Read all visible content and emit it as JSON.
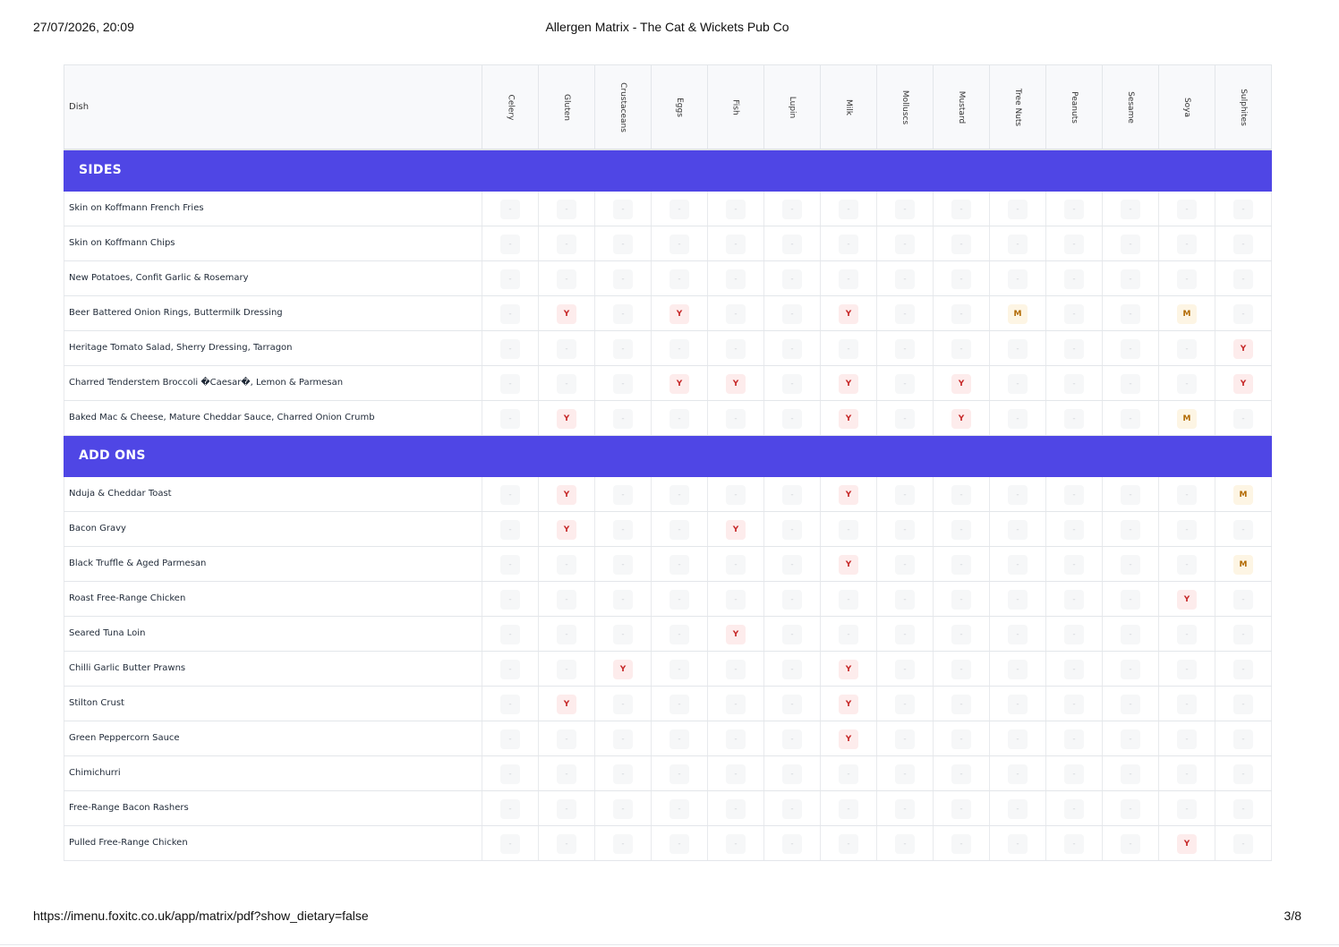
{
  "print_header": {
    "date": "27/07/2026, 20:09",
    "title": "Allergen Matrix - The Cat & Wickets Pub Co"
  },
  "print_footer": {
    "url": "https://imenu.foxitc.co.uk/app/matrix/pdf?show_dietary=false",
    "page": "3/8"
  },
  "colors": {
    "section_bg": "#4f46e5",
    "yes_bg": "#fdecec",
    "yes_text": "#c62828",
    "may_bg": "#fdf5e4",
    "may_text": "#b26a00"
  },
  "table": {
    "dish_header": "Dish",
    "allergens": [
      "Celery",
      "Gluten",
      "Crustaceans",
      "Eggs",
      "Fish",
      "Lupin",
      "Milk",
      "Molluscs",
      "Mustard",
      "Tree Nuts",
      "Peanuts",
      "Sesame",
      "Soya",
      "Sulphites"
    ],
    "sections": [
      {
        "title": "SIDES",
        "rows": [
          {
            "dish": "Skin on Koffmann French Fries",
            "values": [
              "-",
              "-",
              "-",
              "-",
              "-",
              "-",
              "-",
              "-",
              "-",
              "-",
              "-",
              "-",
              "-",
              "-"
            ]
          },
          {
            "dish": "Skin on Koffmann Chips",
            "values": [
              "-",
              "-",
              "-",
              "-",
              "-",
              "-",
              "-",
              "-",
              "-",
              "-",
              "-",
              "-",
              "-",
              "-"
            ]
          },
          {
            "dish": "New Potatoes, Confit Garlic & Rosemary",
            "values": [
              "-",
              "-",
              "-",
              "-",
              "-",
              "-",
              "-",
              "-",
              "-",
              "-",
              "-",
              "-",
              "-",
              "-"
            ]
          },
          {
            "dish": "Beer Battered Onion Rings, Buttermilk Dressing",
            "values": [
              "-",
              "Y",
              "-",
              "Y",
              "-",
              "-",
              "Y",
              "-",
              "-",
              "M",
              "-",
              "-",
              "M",
              "-"
            ]
          },
          {
            "dish": "Heritage Tomato Salad, Sherry Dressing, Tarragon",
            "values": [
              "-",
              "-",
              "-",
              "-",
              "-",
              "-",
              "-",
              "-",
              "-",
              "-",
              "-",
              "-",
              "-",
              "Y"
            ]
          },
          {
            "dish": "Charred Tenderstem Broccoli �Caesar�, Lemon & Parmesan",
            "values": [
              "-",
              "-",
              "-",
              "Y",
              "Y",
              "-",
              "Y",
              "-",
              "Y",
              "-",
              "-",
              "-",
              "-",
              "Y"
            ]
          },
          {
            "dish": "Baked Mac & Cheese, Mature Cheddar Sauce, Charred Onion Crumb",
            "values": [
              "-",
              "Y",
              "-",
              "-",
              "-",
              "-",
              "Y",
              "-",
              "Y",
              "-",
              "-",
              "-",
              "M",
              "-"
            ]
          }
        ]
      },
      {
        "title": "ADD ONS",
        "rows": [
          {
            "dish": "Nduja & Cheddar Toast",
            "values": [
              "-",
              "Y",
              "-",
              "-",
              "-",
              "-",
              "Y",
              "-",
              "-",
              "-",
              "-",
              "-",
              "-",
              "M"
            ]
          },
          {
            "dish": "Bacon Gravy",
            "values": [
              "-",
              "Y",
              "-",
              "-",
              "Y",
              "-",
              "-",
              "-",
              "-",
              "-",
              "-",
              "-",
              "-",
              "-"
            ]
          },
          {
            "dish": "Black Truffle & Aged Parmesan",
            "values": [
              "-",
              "-",
              "-",
              "-",
              "-",
              "-",
              "Y",
              "-",
              "-",
              "-",
              "-",
              "-",
              "-",
              "M"
            ]
          },
          {
            "dish": "Roast Free-Range Chicken",
            "values": [
              "-",
              "-",
              "-",
              "-",
              "-",
              "-",
              "-",
              "-",
              "-",
              "-",
              "-",
              "-",
              "Y",
              "-"
            ]
          },
          {
            "dish": "Seared Tuna Loin",
            "values": [
              "-",
              "-",
              "-",
              "-",
              "Y",
              "-",
              "-",
              "-",
              "-",
              "-",
              "-",
              "-",
              "-",
              "-"
            ]
          },
          {
            "dish": "Chilli Garlic Butter Prawns",
            "values": [
              "-",
              "-",
              "Y",
              "-",
              "-",
              "-",
              "Y",
              "-",
              "-",
              "-",
              "-",
              "-",
              "-",
              "-"
            ]
          },
          {
            "dish": "Stilton Crust",
            "values": [
              "-",
              "Y",
              "-",
              "-",
              "-",
              "-",
              "Y",
              "-",
              "-",
              "-",
              "-",
              "-",
              "-",
              "-"
            ]
          },
          {
            "dish": "Green Peppercorn Sauce",
            "values": [
              "-",
              "-",
              "-",
              "-",
              "-",
              "-",
              "Y",
              "-",
              "-",
              "-",
              "-",
              "-",
              "-",
              "-"
            ]
          },
          {
            "dish": "Chimichurri",
            "values": [
              "-",
              "-",
              "-",
              "-",
              "-",
              "-",
              "-",
              "-",
              "-",
              "-",
              "-",
              "-",
              "-",
              "-"
            ]
          },
          {
            "dish": "Free-Range Bacon Rashers",
            "values": [
              "-",
              "-",
              "-",
              "-",
              "-",
              "-",
              "-",
              "-",
              "-",
              "-",
              "-",
              "-",
              "-",
              "-"
            ]
          },
          {
            "dish": "Pulled Free-Range Chicken",
            "values": [
              "-",
              "-",
              "-",
              "-",
              "-",
              "-",
              "-",
              "-",
              "-",
              "-",
              "-",
              "-",
              "Y",
              "-"
            ]
          }
        ]
      }
    ]
  }
}
